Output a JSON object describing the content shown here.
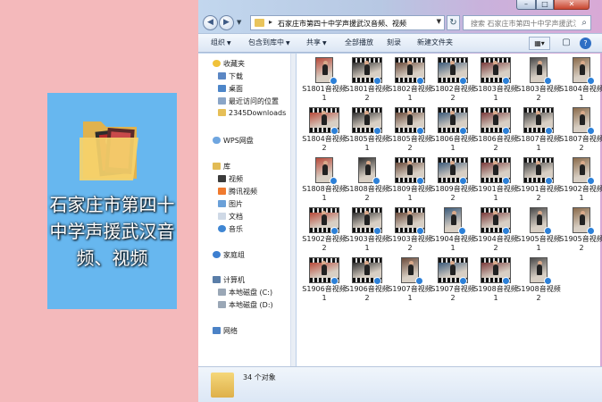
{
  "desktop": {
    "folder_label": "石家庄市第四十中学声援武汉音频、视频"
  },
  "window": {
    "controls": {
      "minimize": "–",
      "maximize": "□",
      "close": "✕"
    },
    "address": {
      "path": "石家庄市第四十中学声援武汉音频、视频",
      "search_placeholder": "搜索 石家庄市第四十中学声援武汉音..."
    },
    "toolbar": {
      "organize": "组织",
      "include_in_library": "包含到库中",
      "share": "共享",
      "play_all": "全部播放",
      "burn": "刻录",
      "new_folder": "新建文件夹"
    },
    "nav": {
      "favorites": "收藏夹",
      "downloads": "下载",
      "desktop": "桌面",
      "recent": "最近访问的位置",
      "downloads2345": "2345Downloads",
      "wps_cloud": "WPS网盘",
      "libraries": "库",
      "videos": "视频",
      "tencent_video": "腾讯视频",
      "pictures": "图片",
      "documents": "文档",
      "music": "音乐",
      "homegroup": "家庭组",
      "computer": "计算机",
      "disk_c": "本地磁盘 (C:)",
      "disk_d": "本地磁盘 (D:)",
      "network": "网络"
    },
    "files": [
      "S1801音视频1",
      "S1801音视频2",
      "S1802音视频1",
      "S1802音视频2",
      "S1803音视频1",
      "S1803音视频2",
      "S1804音视频1",
      "S1804音视频2",
      "S1805音视频1",
      "S1805音视频2",
      "S1806音视频1",
      "S1806音视频2",
      "S1807音视频1",
      "S1807音视频2",
      "S1808音视频1",
      "S1808音视频2",
      "S1809音视频1",
      "S1809音视频2",
      "S1901音视频1",
      "S1901音视频2",
      "S1902音视频1",
      "S1902音视频2",
      "S1903音视频1",
      "S1903音视频2",
      "S1904音视频1",
      "S1904音视频2",
      "S1905音视频 1",
      "S1905音视频 2",
      "S1906音视频1",
      "S1906音视频2",
      "S1907音视频1",
      "S1907音视频2",
      "S1908音视频1",
      "S1908音视频2"
    ],
    "status": {
      "count": "34 个对象"
    }
  }
}
